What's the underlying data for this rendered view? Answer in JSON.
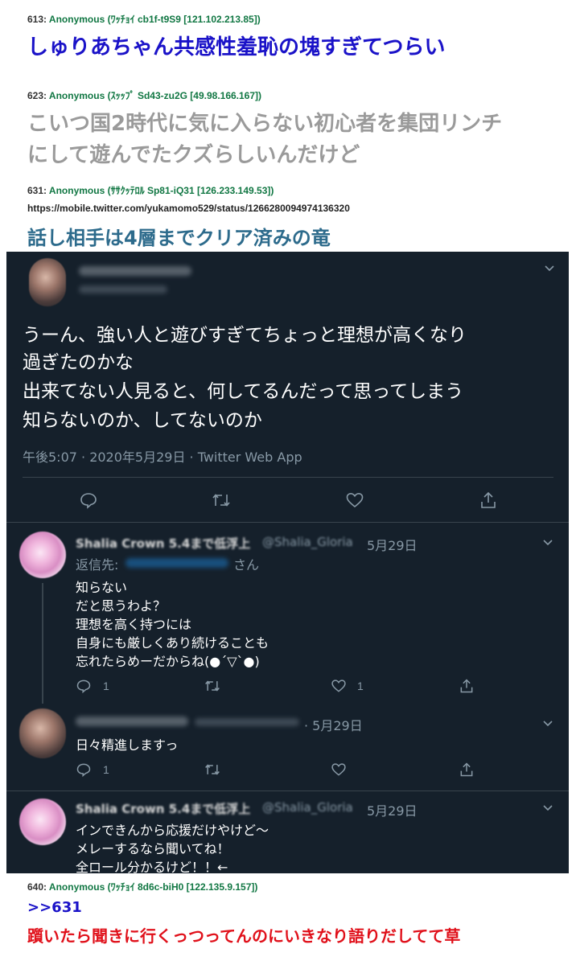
{
  "posts": [
    {
      "number": "613:",
      "name": "Anonymous",
      "id": "(ﾜｯﾁｮｲ cb1f-t9S9 [121.102.213.85])",
      "body": "しゅりあちゃん共感性羞恥の塊すぎてつらい"
    },
    {
      "number": "623:",
      "name": "Anonymous",
      "id": "(ｽｯｯﾌﾟ Sd43-zu2G [49.98.166.167])",
      "body_line1": "こいつ国2時代に気に入らない初心者を集団リンチ",
      "body_line2": "にして遊んでたクズらしいんだけど"
    },
    {
      "number": "631:",
      "name": "Anonymous",
      "id": "(ｻｻｸｯﾃﾛﾙ Sp81-iQ31 [126.233.149.53])",
      "link": "https://mobile.twitter.com/yukamomo529/status/1266280094974136320",
      "body": "話し相手は4層までクリア済みの竜"
    },
    {
      "number": "640:",
      "name": "Anonymous",
      "id": "(ﾜｯﾁｮｲ 8d6c-biH0 [122.135.9.157])",
      "reply": ">>631",
      "body": "躓いたら聞きに行くっつってんのにいきなり語りだしてて草"
    }
  ],
  "tweet": {
    "line1": "うーん、強い人と遊びすぎてちょっと理想が高くなり",
    "line2": "過ぎたのかな",
    "line3": "出来てない人見ると、何してるんだって思ってしまう",
    "line4": "知らないのか、してないのか",
    "meta": "午後5:07 · 2020年5月29日 · Twitter Web App"
  },
  "reply1": {
    "name": "Shalia Crown 5.4まで低浮上",
    "handle": "@Shalia_Gloria",
    "date": "5月29日",
    "reply_to_prefix": "返信先:",
    "reply_to_suffix": "さん",
    "lines": [
      "知らない",
      "だと思うわよ？",
      "理想を高く持つには",
      "自身にも厳しくあり続けることも",
      "忘れたらめーだからね(●´▽`●)"
    ],
    "reply_count": "1",
    "like_count": "1"
  },
  "reply2": {
    "date": "· 5月29日",
    "text": "日々精進しますっ",
    "reply_count": "1"
  },
  "reply3": {
    "name": "Shalia Crown 5.4まで低浮上",
    "handle": "@Shalia_Gloria",
    "date": "5月29日",
    "lines": [
      "インできんから応援だけやけど～",
      "メレーするなら聞いてね！",
      "全ロール分かるけど！！←"
    ]
  },
  "colors": {
    "post_blue": "#1a12c8",
    "post_gray": "#9a9a9a",
    "post_teal": "#2d6b8c",
    "post_red": "#e0101a",
    "name_green": "#117743",
    "twitter_bg": "#15202b",
    "muted": "#8899a6"
  },
  "icons": [
    "reply-icon",
    "retweet-icon",
    "like-icon",
    "share-icon",
    "chevron-down-icon"
  ]
}
